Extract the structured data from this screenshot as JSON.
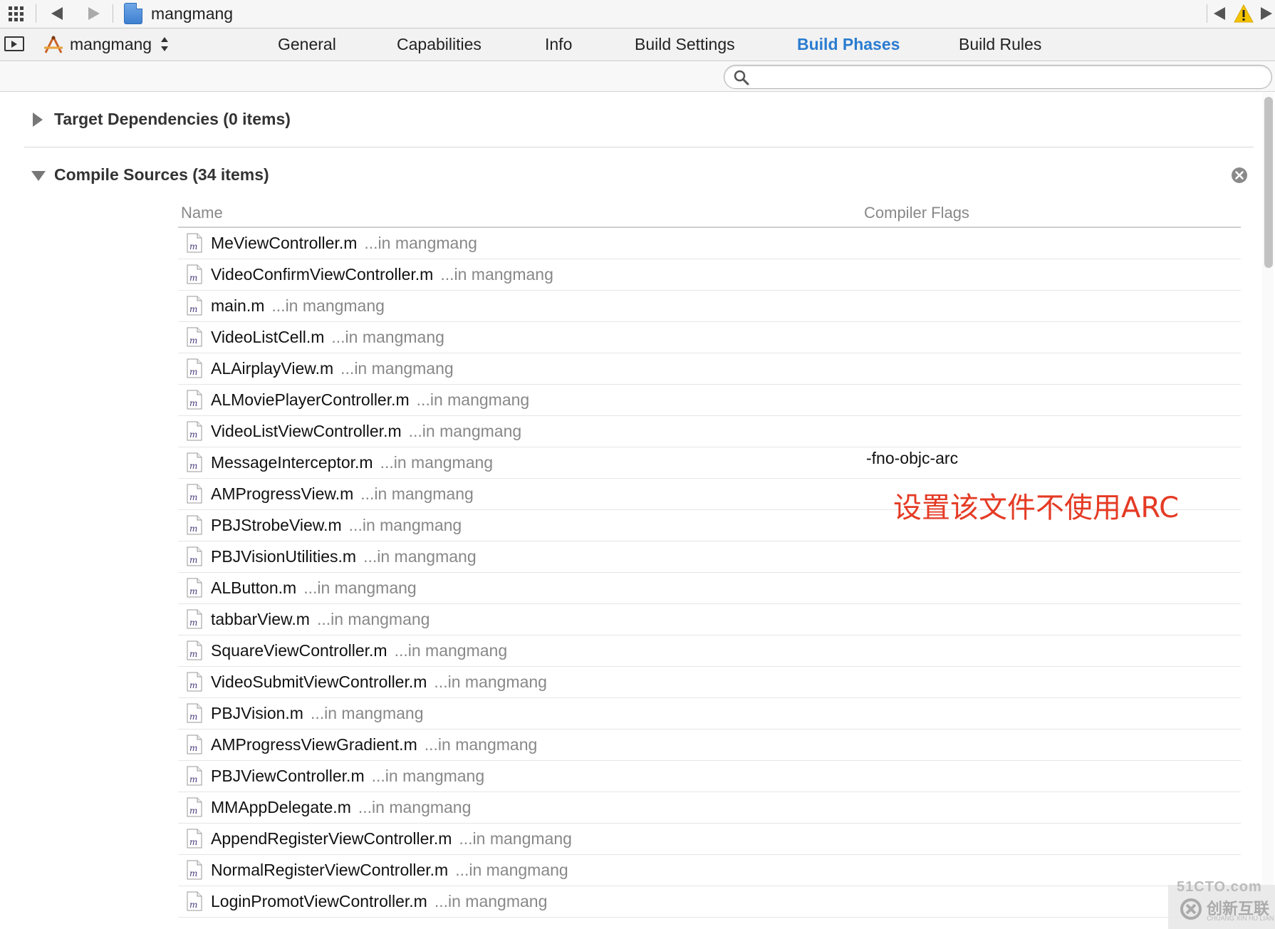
{
  "jumpbar": {
    "project_name": "mangmang"
  },
  "tabbar": {
    "target_name": "mangmang",
    "tabs": [
      {
        "label": "General",
        "active": false
      },
      {
        "label": "Capabilities",
        "active": false
      },
      {
        "label": "Info",
        "active": false
      },
      {
        "label": "Build Settings",
        "active": false
      },
      {
        "label": "Build Phases",
        "active": true
      },
      {
        "label": "Build Rules",
        "active": false
      }
    ]
  },
  "search": {
    "value": "",
    "placeholder": ""
  },
  "phases": {
    "target_dependencies": "Target Dependencies (0 items)",
    "compile_sources": "Compile Sources (34 items)"
  },
  "table": {
    "columns": [
      "Name",
      "Compiler Flags"
    ],
    "rows": [
      {
        "name": "MeViewController.m",
        "location": "...in mangmang",
        "flags": ""
      },
      {
        "name": "VideoConfirmViewController.m",
        "location": "...in mangmang",
        "flags": ""
      },
      {
        "name": "main.m",
        "location": "...in mangmang",
        "flags": ""
      },
      {
        "name": "VideoListCell.m",
        "location": "...in mangmang",
        "flags": ""
      },
      {
        "name": "ALAirplayView.m",
        "location": "...in mangmang",
        "flags": ""
      },
      {
        "name": "ALMoviePlayerController.m",
        "location": "...in mangmang",
        "flags": ""
      },
      {
        "name": "VideoListViewController.m",
        "location": "...in mangmang",
        "flags": ""
      },
      {
        "name": "MessageInterceptor.m",
        "location": "...in mangmang",
        "flags": "-fno-objc-arc"
      },
      {
        "name": "AMProgressView.m",
        "location": "...in mangmang",
        "flags": ""
      },
      {
        "name": "PBJStrobeView.m",
        "location": "...in mangmang",
        "flags": ""
      },
      {
        "name": "PBJVisionUtilities.m",
        "location": "...in mangmang",
        "flags": ""
      },
      {
        "name": "ALButton.m",
        "location": "...in mangmang",
        "flags": ""
      },
      {
        "name": "tabbarView.m",
        "location": "...in mangmang",
        "flags": ""
      },
      {
        "name": "SquareViewController.m",
        "location": "...in mangmang",
        "flags": ""
      },
      {
        "name": "VideoSubmitViewController.m",
        "location": "...in mangmang",
        "flags": ""
      },
      {
        "name": "PBJVision.m",
        "location": "...in mangmang",
        "flags": ""
      },
      {
        "name": "AMProgressViewGradient.m",
        "location": "...in mangmang",
        "flags": ""
      },
      {
        "name": "PBJViewController.m",
        "location": "...in mangmang",
        "flags": ""
      },
      {
        "name": "MMAppDelegate.m",
        "location": "...in mangmang",
        "flags": ""
      },
      {
        "name": "AppendRegisterViewController.m",
        "location": "...in mangmang",
        "flags": ""
      },
      {
        "name": "NormalRegisterViewController.m",
        "location": "...in mangmang",
        "flags": ""
      },
      {
        "name": "LoginPromotViewController.m",
        "location": "...in mangmang",
        "flags": ""
      }
    ]
  },
  "annotation": {
    "text": "设置该文件不使用ARC",
    "color": "#e53a24"
  },
  "watermark": {
    "top": "51CTO.com",
    "brand": "创新互联",
    "sub": "CHUANG XIN HU LIAN"
  },
  "colors": {
    "accent": "#2a7cd1",
    "warning": "#f5c400"
  },
  "icons": {
    "file": "objc-m-file-icon",
    "search": "search-icon",
    "remove": "remove-circle-icon",
    "warning": "warning-icon"
  }
}
